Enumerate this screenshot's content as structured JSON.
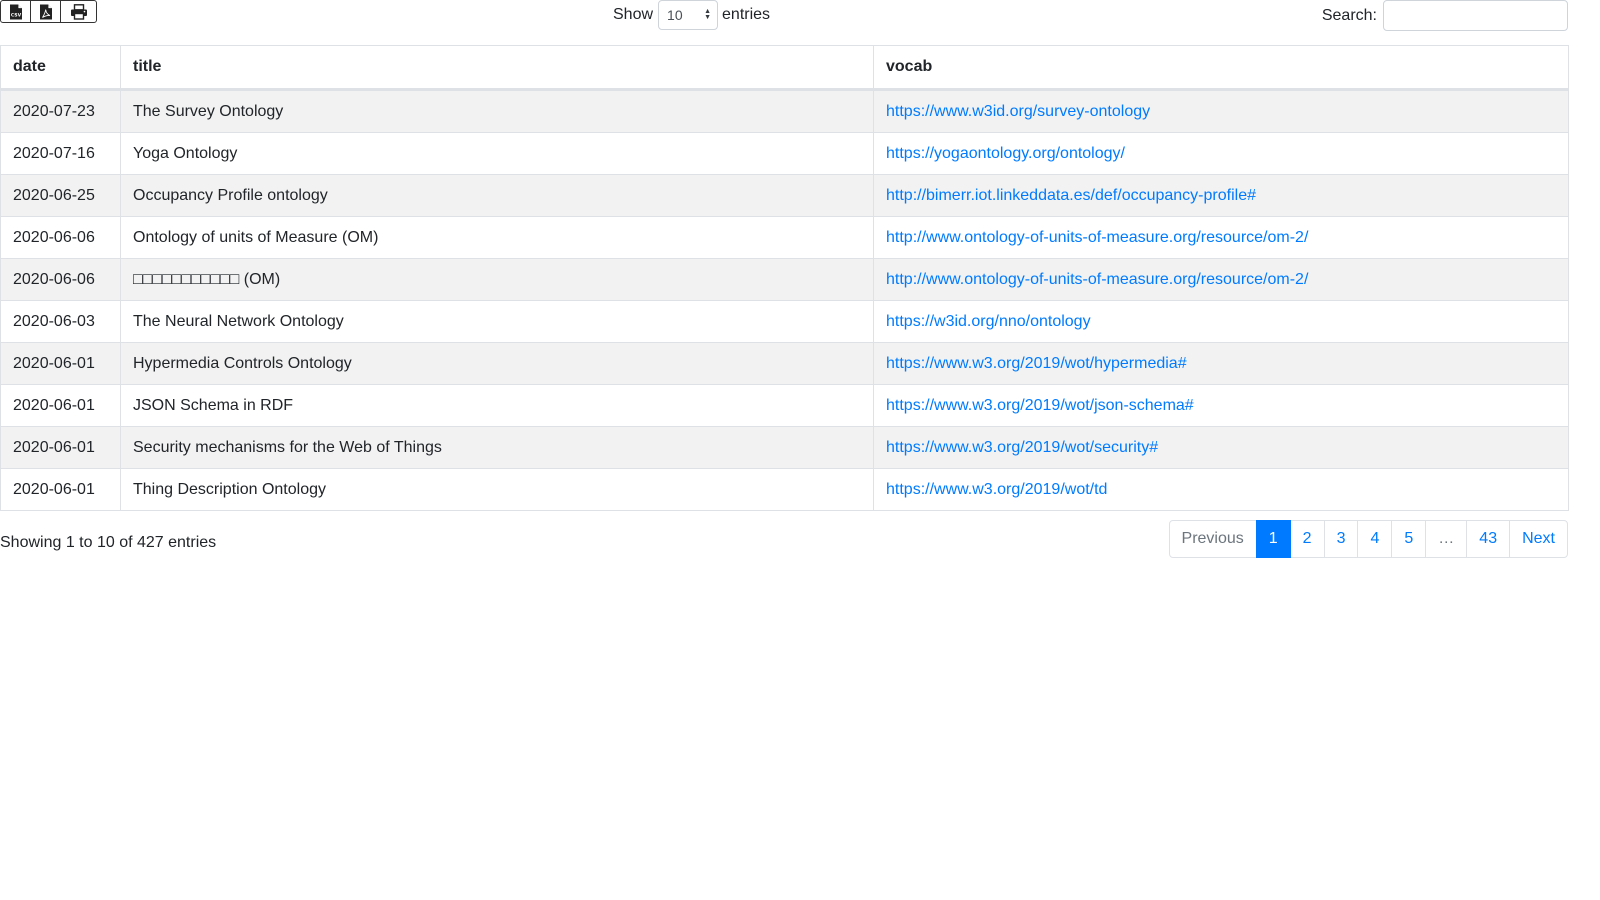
{
  "toolbar": {
    "buttons": [
      {
        "icon": "csv-file-icon"
      },
      {
        "icon": "pdf-file-icon"
      },
      {
        "icon": "print-icon"
      }
    ]
  },
  "length": {
    "label_before": "Show",
    "selected": "10",
    "label_after": "entries"
  },
  "search": {
    "label": "Search:",
    "value": "",
    "placeholder": ""
  },
  "table": {
    "columns": [
      "date",
      "title",
      "vocab"
    ],
    "rows": [
      {
        "date": "2020-07-23",
        "title": "The Survey Ontology",
        "vocab": "https://www.w3id.org/survey-ontology"
      },
      {
        "date": "2020-07-16",
        "title": "Yoga Ontology",
        "vocab": "https://yogaontology.org/ontology/"
      },
      {
        "date": "2020-06-25",
        "title": "Occupancy Profile ontology",
        "vocab": "http://bimerr.iot.linkeddata.es/def/occupancy-profile#"
      },
      {
        "date": "2020-06-06",
        "title": "Ontology of units of Measure (OM)",
        "vocab": "http://www.ontology-of-units-of-measure.org/resource/om-2/"
      },
      {
        "date": "2020-06-06",
        "title": "□□□□□□□□□□□ (OM)",
        "vocab": "http://www.ontology-of-units-of-measure.org/resource/om-2/"
      },
      {
        "date": "2020-06-03",
        "title": "The Neural Network Ontology",
        "vocab": "https://w3id.org/nno/ontology"
      },
      {
        "date": "2020-06-01",
        "title": "Hypermedia Controls Ontology",
        "vocab": "https://www.w3.org/2019/wot/hypermedia#"
      },
      {
        "date": "2020-06-01",
        "title": "JSON Schema in RDF",
        "vocab": "https://www.w3.org/2019/wot/json-schema#"
      },
      {
        "date": "2020-06-01",
        "title": "Security mechanisms for the Web of Things",
        "vocab": "https://www.w3.org/2019/wot/security#"
      },
      {
        "date": "2020-06-01",
        "title": "Thing Description Ontology",
        "vocab": "https://www.w3.org/2019/wot/td"
      }
    ]
  },
  "info": "Showing 1 to 10 of 427 entries",
  "pagination": {
    "previous": "Previous",
    "pages": [
      "1",
      "2",
      "3",
      "4",
      "5",
      "…",
      "43"
    ],
    "active": "1",
    "next": "Next"
  },
  "colors": {
    "link": "#007bff",
    "active_page": "#007bff",
    "stripe": "#f2f2f2"
  }
}
